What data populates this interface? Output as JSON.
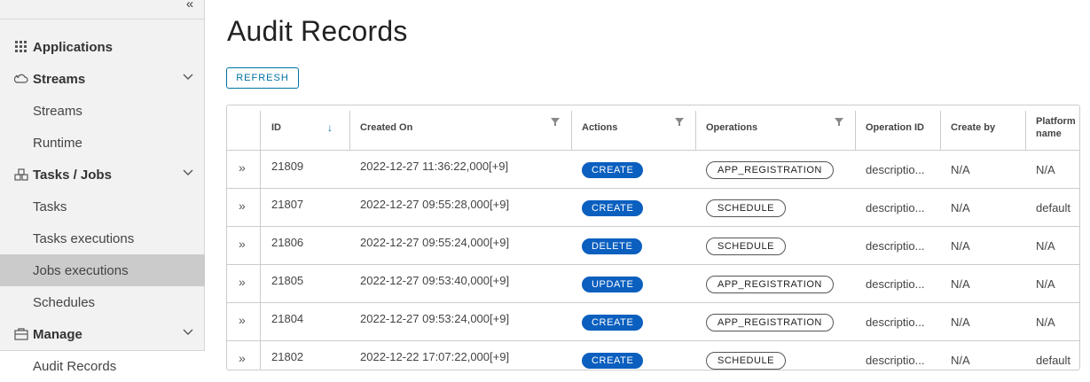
{
  "sidebar": {
    "items": [
      {
        "label": "Applications",
        "kind": "header",
        "icon": "grid-icon"
      },
      {
        "label": "Streams",
        "kind": "header",
        "icon": "cloud-icon",
        "expanded": true
      },
      {
        "label": "Streams",
        "kind": "sub"
      },
      {
        "label": "Runtime",
        "kind": "sub"
      },
      {
        "label": "Tasks / Jobs",
        "kind": "header",
        "icon": "boxes-icon",
        "expanded": true
      },
      {
        "label": "Tasks",
        "kind": "sub"
      },
      {
        "label": "Tasks executions",
        "kind": "sub"
      },
      {
        "label": "Jobs executions",
        "kind": "sub",
        "active": true
      },
      {
        "label": "Schedules",
        "kind": "sub"
      },
      {
        "label": "Manage",
        "kind": "header",
        "icon": "briefcase-icon",
        "expanded": true
      },
      {
        "label": "Audit Records",
        "kind": "sub"
      }
    ]
  },
  "main": {
    "title": "Audit Records",
    "refresh_label": "REFRESH"
  },
  "grid": {
    "columns": [
      "ID",
      "Created On",
      "Actions",
      "Operations",
      "Operation ID",
      "Create by",
      "Platform name"
    ],
    "rows": [
      {
        "id": "21809",
        "created": "2022-12-27 11:36:22,000[+9]",
        "action": "CREATE",
        "operation": "APP_REGISTRATION",
        "op_id": "descriptio...",
        "by": "N/A",
        "platform": "N/A"
      },
      {
        "id": "21807",
        "created": "2022-12-27 09:55:28,000[+9]",
        "action": "CREATE",
        "operation": "SCHEDULE",
        "op_id": "descriptio...",
        "by": "N/A",
        "platform": "default"
      },
      {
        "id": "21806",
        "created": "2022-12-27 09:55:24,000[+9]",
        "action": "DELETE",
        "operation": "SCHEDULE",
        "op_id": "descriptio...",
        "by": "N/A",
        "platform": "N/A"
      },
      {
        "id": "21805",
        "created": "2022-12-27 09:53:40,000[+9]",
        "action": "UPDATE",
        "operation": "APP_REGISTRATION",
        "op_id": "descriptio...",
        "by": "N/A",
        "platform": "N/A"
      },
      {
        "id": "21804",
        "created": "2022-12-27 09:53:24,000[+9]",
        "action": "CREATE",
        "operation": "APP_REGISTRATION",
        "op_id": "descriptio...",
        "by": "N/A",
        "platform": "N/A"
      },
      {
        "id": "21802",
        "created": "2022-12-22 17:07:22,000[+9]",
        "action": "CREATE",
        "operation": "SCHEDULE",
        "op_id": "descriptio...",
        "by": "N/A",
        "platform": "default"
      }
    ]
  },
  "colors": {
    "accent": "#0072a3",
    "badge": "#0b5fbf",
    "sidebar_bg": "#f2f2f2",
    "active_bg": "#cbcbcb"
  }
}
